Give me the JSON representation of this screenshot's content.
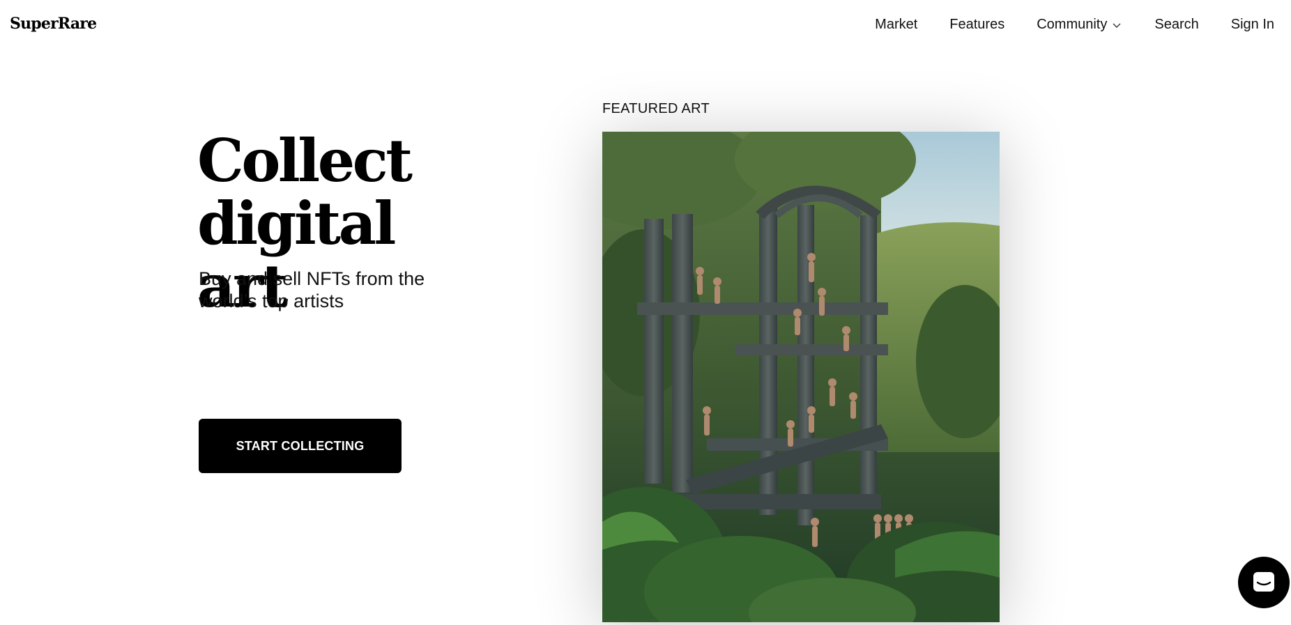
{
  "header": {
    "logo": "SuperRare",
    "nav": {
      "market": "Market",
      "features": "Features",
      "community": "Community",
      "search": "Search",
      "sign_in": "Sign In"
    }
  },
  "hero": {
    "title_line1": "Collect",
    "title_line2": "digital art",
    "subtitle_line1": "Buy and sell NFTs from the",
    "subtitle_line2": "world’s top artists",
    "cta_label": "START COLLECTING"
  },
  "featured": {
    "label": "FEATURED ART"
  },
  "colors": {
    "text": "#111111",
    "button_bg": "#000000",
    "button_text": "#ffffff",
    "background": "#ffffff"
  },
  "icons": {
    "community_dropdown": "chevron-down-icon",
    "chat": "chat-icon"
  }
}
